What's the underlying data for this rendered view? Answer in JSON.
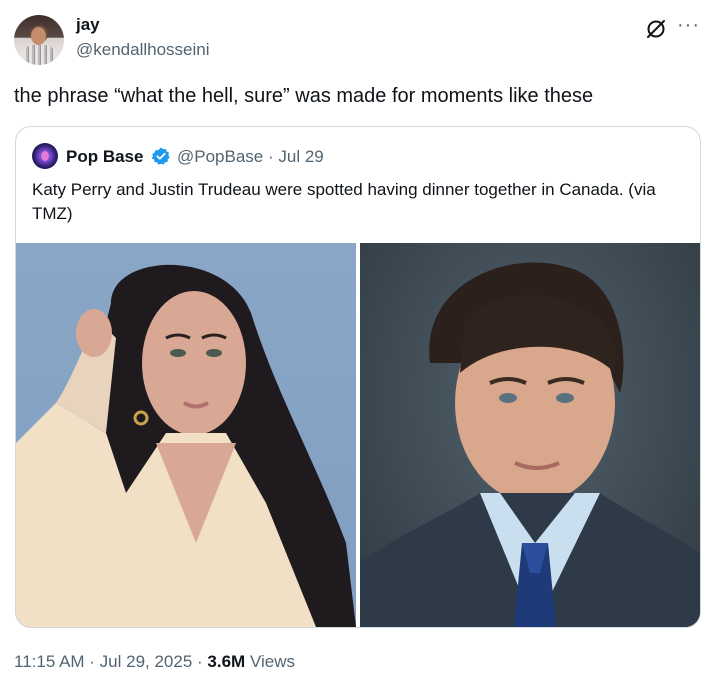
{
  "author": {
    "name": "jay",
    "handle": "@kendallhosseini"
  },
  "tweet": {
    "text": "the phrase “what the hell, sure” was made for moments like these"
  },
  "quoted": {
    "name": "Pop Base",
    "handle_date": "@PopBase · Jul 29",
    "text": "Katy Perry and Justin Trudeau were spotted having dinner together in Canada. (via TMZ)",
    "images": [
      "photo-katy-perry",
      "photo-justin-trudeau"
    ]
  },
  "meta": {
    "time_date": "11:15 AM · Jul 29, 2025 · ",
    "views_count": "3.6M",
    "views_label": " Views"
  },
  "icons": {
    "grok": "grok-icon",
    "more": "more-icon",
    "verified": "verified-icon"
  },
  "colors": {
    "verified": "#1d9bf0",
    "secondary_text": "#536471",
    "border": "#cfd9de"
  }
}
